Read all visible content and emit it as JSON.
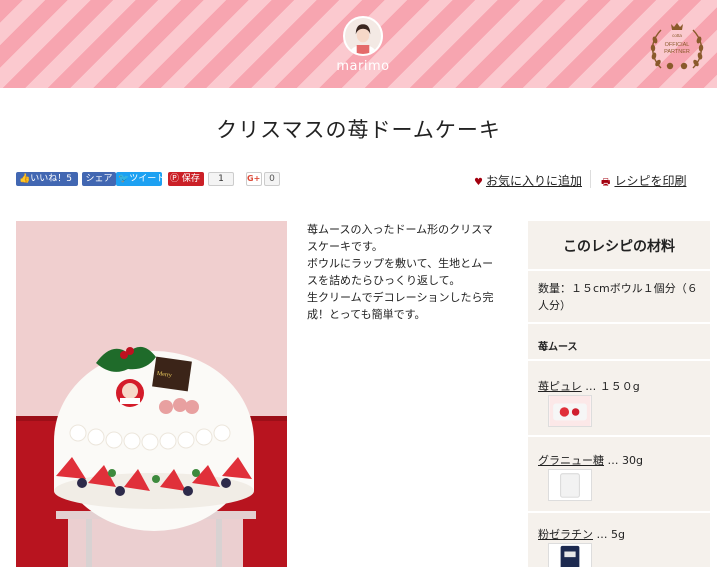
{
  "header": {
    "user_name": "marimo",
    "badge": {
      "brand": "cotta",
      "line1": "OFFICIAL",
      "line2": "PARTNER"
    }
  },
  "recipe": {
    "title": "クリスマスの苺ドームケーキ",
    "description": [
      "苺ムースの入ったドーム形のクリスマスケーキです。",
      "ボウルにラップを敷いて、生地とムースを詰めたらひっくり返して。",
      "生クリームでデコレーションしたら完成！とっても簡単です。"
    ],
    "photo_icon": "christmas-dome-cake-photo"
  },
  "share": {
    "fb_like": "いいね！5",
    "fb_share": "シェア",
    "tweet": "ツイート",
    "pin_save": "保存",
    "pin_count": "1",
    "gplus": "G+1",
    "gplus_count": "0"
  },
  "actions": {
    "favorite": "お気に入りに追加",
    "print": "レシピを印刷",
    "favorite_icon": "heart-icon",
    "print_icon": "printer-icon"
  },
  "ingredients": {
    "title": "このレシピの材料",
    "quantity": "数量：１５cmボウル１個分（６人分）",
    "group": "苺ムース",
    "items": [
      {
        "name": "苺ピュレ",
        "amount": " … １５０g"
      },
      {
        "name": "グラニュー糖",
        "amount": " … 30g"
      },
      {
        "name": "粉ゼラチン",
        "amount": " … 5g"
      }
    ]
  },
  "colors": {
    "header_stripe_dark": "#f7a5b0",
    "header_stripe_light": "#fbc9cf",
    "panel_bg": "#f5f1ec",
    "accent_red": "#a3000f"
  }
}
